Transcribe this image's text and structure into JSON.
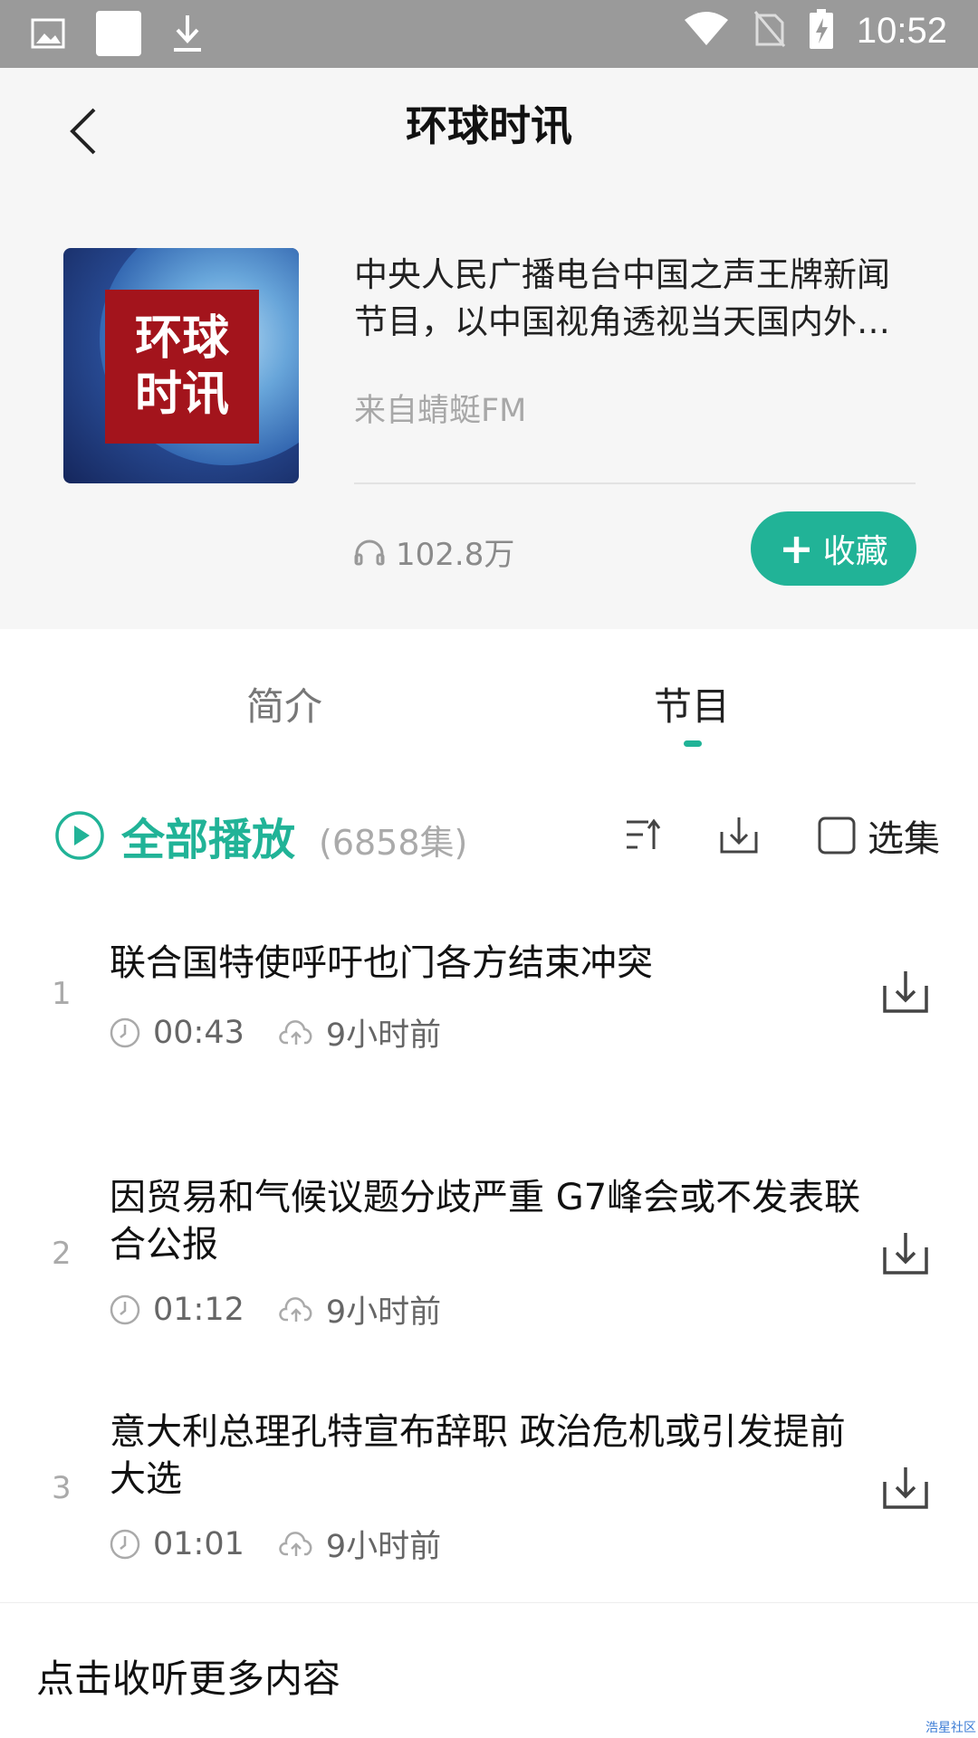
{
  "status_bar": {
    "time": "10:52"
  },
  "header": {
    "title": "环球时讯",
    "cover_text": "环球\n时讯",
    "description": "中央人民广播电台中国之声王牌新闻节目，以中国视角透视当天国内外…",
    "source": "来自蜻蜓FM",
    "listen_count": "102.8万",
    "favorite_label": "收藏"
  },
  "tabs": [
    {
      "label": "简介"
    },
    {
      "label": "节目"
    }
  ],
  "toolbar": {
    "play_all_label": "全部播放",
    "episode_count": "(6858集)",
    "select_label": "选集"
  },
  "episodes": [
    {
      "index": "1",
      "title": "联合国特使呼吁也门各方结束冲突",
      "duration": "00:43",
      "uploaded": "9小时前"
    },
    {
      "index": "2",
      "title": "因贸易和气候议题分歧严重 G7峰会或不发表联合公报",
      "duration": "01:12",
      "uploaded": "9小时前"
    },
    {
      "index": "3",
      "title": "意大利总理孔特宣布辞职 政治危机或引发提前大选",
      "duration": "01:01",
      "uploaded": "9小时前"
    }
  ],
  "bottom_bar": {
    "more_label": "点击收听更多内容"
  },
  "watermark": "浩星社区",
  "colors": {
    "accent": "#21b397",
    "status_bar": "#9a9a9a"
  }
}
